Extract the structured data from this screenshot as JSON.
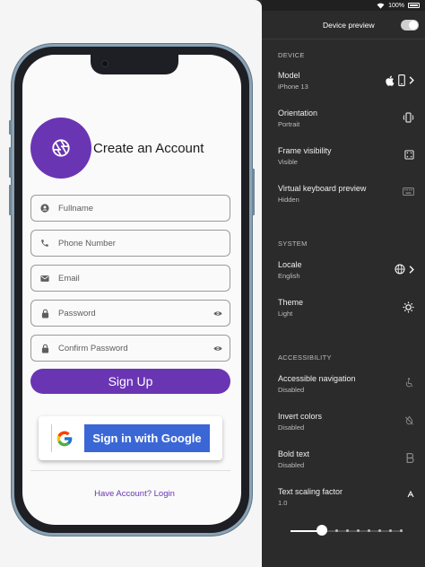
{
  "status_bar": {
    "battery": "100%"
  },
  "app": {
    "title": "Create an Account",
    "fields": {
      "fullname": "Fullname",
      "phone": "Phone Number",
      "email": "Email",
      "password": "Password",
      "confirm_password": "Confirm Password"
    },
    "signup_label": "Sign Up",
    "google_label": "Sign in with Google",
    "login_link": "Have Account? Login"
  },
  "panel": {
    "title": "Device preview",
    "enabled": true,
    "sections": {
      "device": "DEVICE",
      "system": "SYSTEM",
      "accessibility": "ACCESSIBILITY"
    },
    "device": {
      "model": {
        "label": "Model",
        "value": "iPhone 13"
      },
      "orientation": {
        "label": "Orientation",
        "value": "Portrait"
      },
      "frame": {
        "label": "Frame visibility",
        "value": "Visible"
      },
      "keyboard": {
        "label": "Virtual keyboard preview",
        "value": "Hidden"
      }
    },
    "system": {
      "locale": {
        "label": "Locale",
        "value": "English"
      },
      "theme": {
        "label": "Theme",
        "value": "Light"
      }
    },
    "accessibility": {
      "navigation": {
        "label": "Accessible navigation",
        "value": "Disabled"
      },
      "invert": {
        "label": "Invert colors",
        "value": "Disabled"
      },
      "bold": {
        "label": "Bold text",
        "value": "Disabled"
      },
      "scaling": {
        "label": "Text scaling factor",
        "value": "1.0"
      }
    },
    "text_scale_level": 0.25
  },
  "colors": {
    "primary": "#6a35b3",
    "google_blue": "#3b67d6",
    "panel_bg": "#2b2b2b",
    "phone_frame": "#8aa2b4"
  },
  "icons": {
    "logo": "camera-aperture-icon",
    "fullname": "person-icon",
    "phone": "phone-icon",
    "email": "mail-icon",
    "password": "lock-icon",
    "visibility": "eye-icon",
    "model_os": "apple-icon",
    "model_device": "smartphone-icon",
    "orientation": "screen-rotation-icon",
    "frame": "frame-icon",
    "keyboard": "keyboard-icon",
    "locale": "globe-icon",
    "theme": "brightness-icon",
    "navigation": "accessibility-icon",
    "invert": "invert-colors-off-icon",
    "bold": "bold-icon",
    "scaling": "text-size-icon"
  }
}
